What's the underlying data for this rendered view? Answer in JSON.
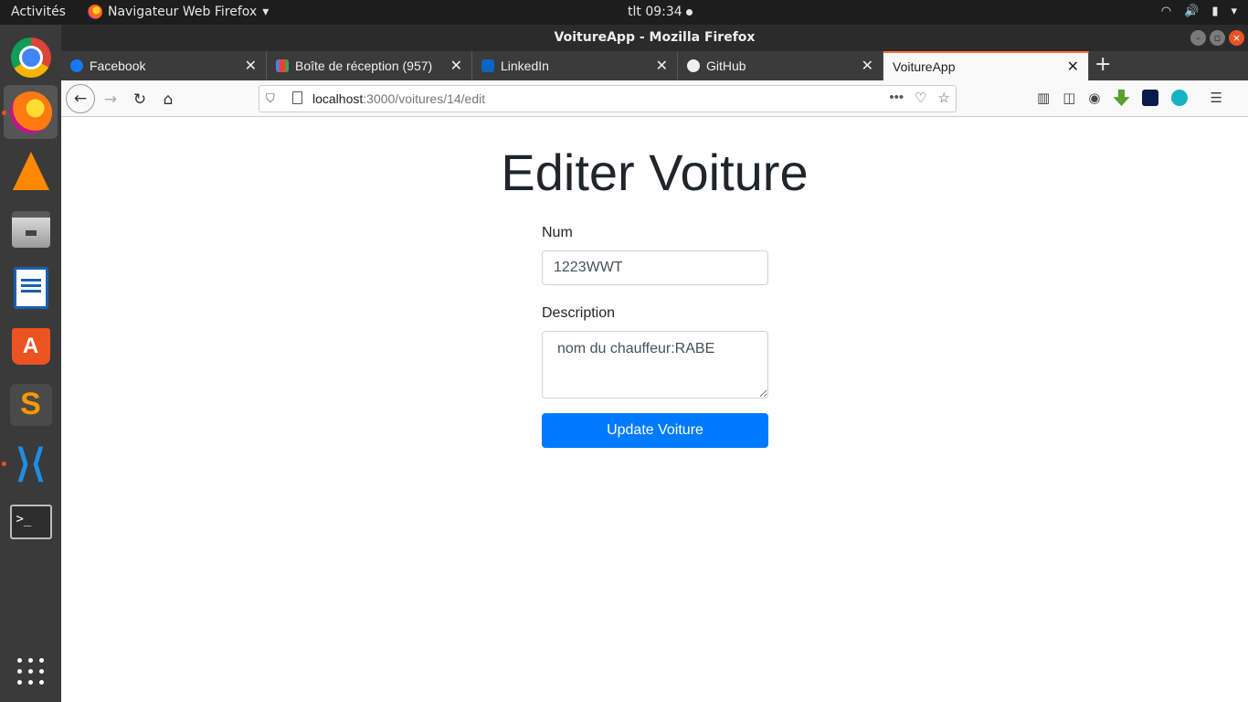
{
  "topbar": {
    "activities": "Activités",
    "app_menu": "Navigateur Web Firefox",
    "clock": "tlt 09:34"
  },
  "window": {
    "title": "VoitureApp - Mozilla Firefox"
  },
  "tabs": [
    {
      "label": "Facebook",
      "favicon_color": "#1877f2",
      "active": false
    },
    {
      "label": "Boîte de réception (957)",
      "favicon_color": "#ea4335",
      "active": false
    },
    {
      "label": "LinkedIn",
      "favicon_color": "#0a66c2",
      "active": false
    },
    {
      "label": "GitHub",
      "favicon_color": "#24292e",
      "active": false
    },
    {
      "label": "VoitureApp",
      "favicon_color": "",
      "active": true
    }
  ],
  "urlbar": {
    "host": "localhost",
    "path": ":3000/voitures/14/edit"
  },
  "page": {
    "heading": "Editer Voiture",
    "num_label": "Num",
    "num_value": "1223WWT",
    "description_label": "Description",
    "description_value": "nom du chauffeur:RABE",
    "submit_label": "Update Voiture"
  },
  "colors": {
    "primary_button": "#007bff",
    "ubuntu_accent": "#e95420",
    "firefox_tab_highlight": "#ff7139"
  }
}
